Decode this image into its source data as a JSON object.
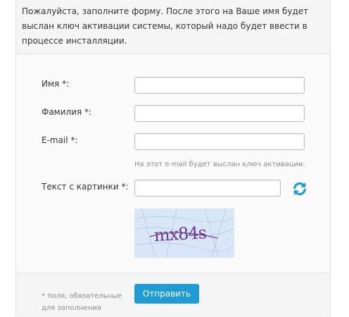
{
  "intro": {
    "text": "Пожалуйста, заполните форму. После этого на Ваше имя будет выслан ключ активации системы, который надо будет ввести в процессе инсталляции."
  },
  "form": {
    "first_name": {
      "label": "Имя *:",
      "value": ""
    },
    "last_name": {
      "label": "Фамилия *:",
      "value": ""
    },
    "email": {
      "label": "E-mail *:",
      "value": "",
      "hint": "На этот e-mail будет выслан ключ активации."
    },
    "captcha": {
      "label": "Текст с картинки *:",
      "value": "",
      "image_text": "mx84s",
      "refresh_icon": "refresh-icon"
    }
  },
  "footer": {
    "required_note": "* поля, обязательные для заполнения",
    "submit_label": "Отправить"
  },
  "colors": {
    "accent": "#1f9bd6",
    "captcha_bg": "#d9e6f7",
    "captcha_text": "#6a3d8c"
  }
}
